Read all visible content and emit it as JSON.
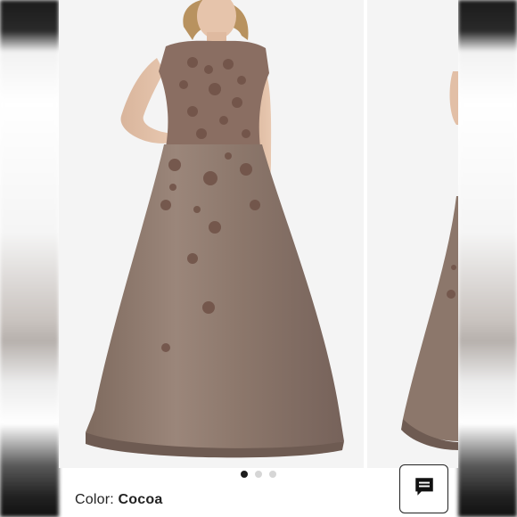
{
  "product": {
    "color_label": "Color:",
    "color_value": "Cocoa"
  },
  "carousel": {
    "slide_count": 3,
    "active_index": 0
  },
  "colors": {
    "dress": "#8f7a6d",
    "lace": "#7a5a4e",
    "active_dot": "#1c1c1c",
    "inactive_dot": "#d6d6d6"
  },
  "icons": {
    "chat": "chat-bubble-icon"
  }
}
